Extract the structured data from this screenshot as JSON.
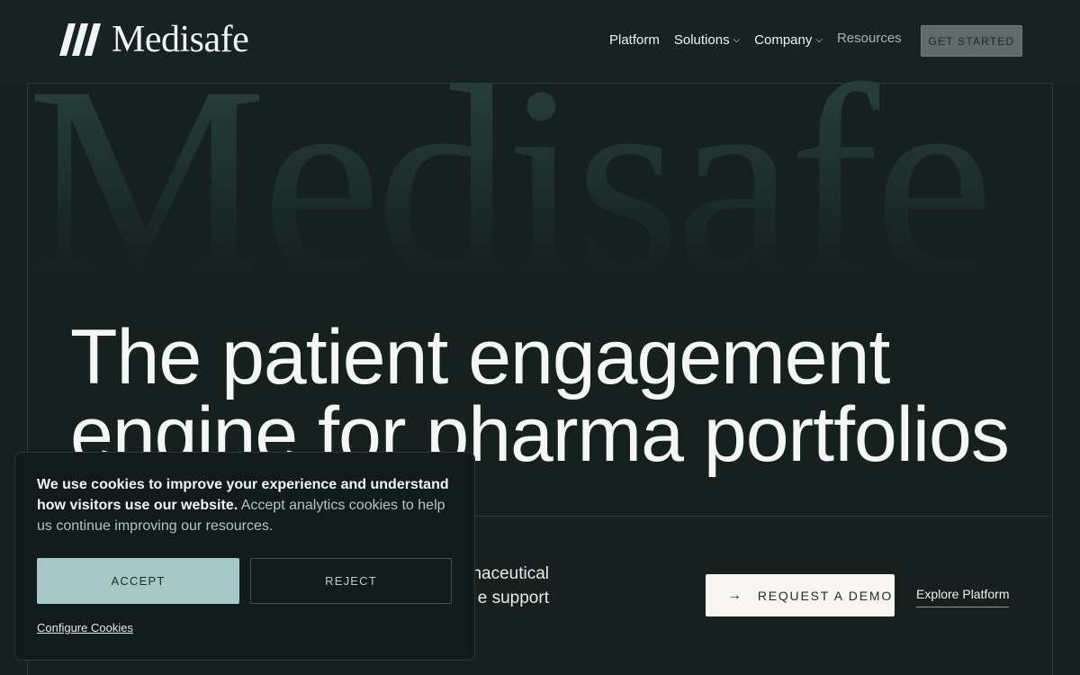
{
  "brand": {
    "name": "Medisafe"
  },
  "nav": {
    "items": [
      {
        "label": "Platform"
      },
      {
        "label": "Solutions"
      },
      {
        "label": "Company"
      },
      {
        "label": "Resources"
      }
    ],
    "cta_label": "GET STARTED"
  },
  "hero": {
    "watermark": "Medisafe",
    "title_line1": "The patient engagement",
    "title_line2": "engine for pharma portfolios",
    "subtitle_line1": "naceutical",
    "subtitle_line2": "e support",
    "demo_button_label": "REQUEST A DEMO",
    "explore_link_label": "Explore Platform"
  },
  "cookie": {
    "strong_text": "We use cookies to improve your experience and understand how visitors use our website.",
    "body_text": " Accept analytics cookies to help us continue improving our resources.",
    "accept_label": "ACCEPT",
    "reject_label": "REJECT",
    "configure_label": "Configure Cookies"
  },
  "colors": {
    "background": "#15201f",
    "accept_button": "#a6c9c8",
    "cta_button": "#5f6b69"
  }
}
